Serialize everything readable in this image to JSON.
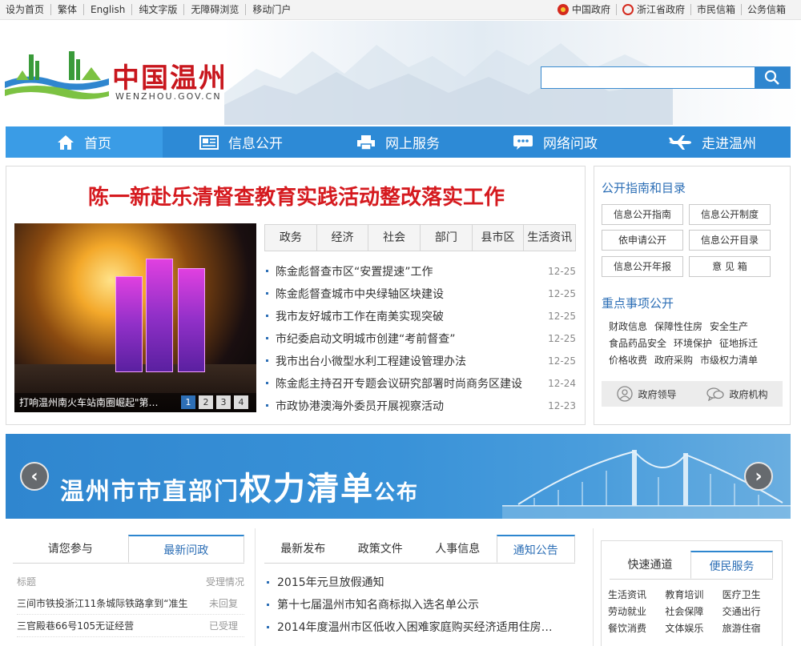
{
  "topbar": {
    "left": [
      "设为首页",
      "繁体",
      "English",
      "纯文字版",
      "无障碍浏览",
      "移动门户"
    ],
    "right": [
      "中国政府",
      "浙江省政府",
      "市民信箱",
      "公务信箱"
    ]
  },
  "header": {
    "logo_title": "中国温州",
    "logo_sub": "WENZHOU.GOV.CN",
    "search_placeholder": ""
  },
  "nav": [
    "首页",
    "信息公开",
    "网上服务",
    "网络问政",
    "走进温州"
  ],
  "headline": "陈一新赴乐清督查教育实践活动整改落实工作",
  "slideshow": {
    "caption": "打响温州南火车站南圈崛起\"第…",
    "pages": [
      "1",
      "2",
      "3",
      "4"
    ]
  },
  "news_tabs": [
    "政务",
    "经济",
    "社会",
    "部门",
    "县市区",
    "生活资讯"
  ],
  "news": [
    {
      "title": "陈金彪督查市区“安置提速”工作",
      "date": "12-25"
    },
    {
      "title": "陈金彪督查城市中央绿轴区块建设",
      "date": "12-25"
    },
    {
      "title": "我市友好城市工作在南美实现突破",
      "date": "12-25"
    },
    {
      "title": "市纪委启动文明城市创建“考前督查”",
      "date": "12-25"
    },
    {
      "title": "我市出台小微型水利工程建设管理办法",
      "date": "12-25"
    },
    {
      "title": "陈金彪主持召开专题会议研究部署时尚商务区建设",
      "date": "12-24"
    },
    {
      "title": "市政协港澳海外委员开展视察活动",
      "date": "12-23"
    }
  ],
  "right": {
    "guide_title": "公开指南和目录",
    "guide_buttons": [
      "信息公开指南",
      "信息公开制度",
      "依申请公开",
      "信息公开目录",
      "信息公开年报",
      "意 见 箱"
    ],
    "keys_title": "重点事项公开",
    "keys": [
      [
        "财政信息",
        "保障性住房",
        "安全生产"
      ],
      [
        "食品药品安全",
        "环境保护",
        "征地拆迁"
      ],
      [
        "价格收费",
        "政府采购",
        "市级权力清单"
      ]
    ],
    "leader": "政府领导",
    "org": "政府机构"
  },
  "banner": {
    "part1": "温州市市直部门",
    "part2": "权力清单",
    "part3": "公布"
  },
  "participate": {
    "tabs": [
      "请您参与",
      "最新问政"
    ],
    "col_title": "标题",
    "col_status": "受理情况",
    "rows": [
      {
        "title": "三间市铁投浙江11条城际铁路拿到“准生",
        "status": "未回复"
      },
      {
        "title": "三官殿巷66号105无证经营",
        "status": "已受理"
      }
    ]
  },
  "publish": {
    "tabs": [
      "最新发布",
      "政策文件",
      "人事信息",
      "通知公告"
    ],
    "rows": [
      "2015年元旦放假通知",
      "第十七届温州市知名商标拟入选名单公示",
      "2014年度温州市区低收入困难家庭购买经济适用住房…"
    ]
  },
  "services": {
    "tabs": [
      "快速通道",
      "便民服务"
    ],
    "items": [
      "生活资讯",
      "教育培训",
      "医疗卫生",
      "劳动就业",
      "社会保障",
      "交通出行",
      "餐饮消费",
      "文体娱乐",
      "旅游住宿"
    ]
  }
}
